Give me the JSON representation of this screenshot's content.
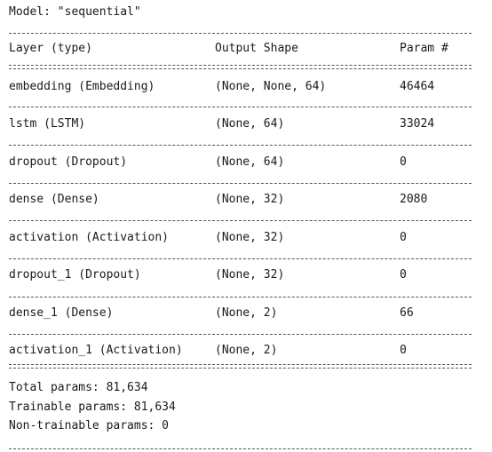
{
  "model_title": "Model: \"sequential\"",
  "columns": {
    "layer": "Layer (type)",
    "output_shape": "Output Shape",
    "params": "Param #"
  },
  "layers": [
    {
      "layer": "embedding (Embedding)",
      "output_shape": "(None, None, 64)",
      "params": "46464"
    },
    {
      "layer": "lstm (LSTM)",
      "output_shape": "(None, 64)",
      "params": "33024"
    },
    {
      "layer": "dropout (Dropout)",
      "output_shape": "(None, 64)",
      "params": "0"
    },
    {
      "layer": "dense (Dense)",
      "output_shape": "(None, 32)",
      "params": "2080"
    },
    {
      "layer": "activation (Activation)",
      "output_shape": "(None, 32)",
      "params": "0"
    },
    {
      "layer": "dropout_1 (Dropout)",
      "output_shape": "(None, 32)",
      "params": "0"
    },
    {
      "layer": "dense_1 (Dense)",
      "output_shape": "(None, 2)",
      "params": "66"
    },
    {
      "layer": "activation_1 (Activation)",
      "output_shape": "(None, 2)",
      "params": "0"
    }
  ],
  "totals": {
    "total": "Total params: 81,634",
    "trainable": "Trainable params: 81,634",
    "non_trainable": "Non-trainable params: 0"
  }
}
